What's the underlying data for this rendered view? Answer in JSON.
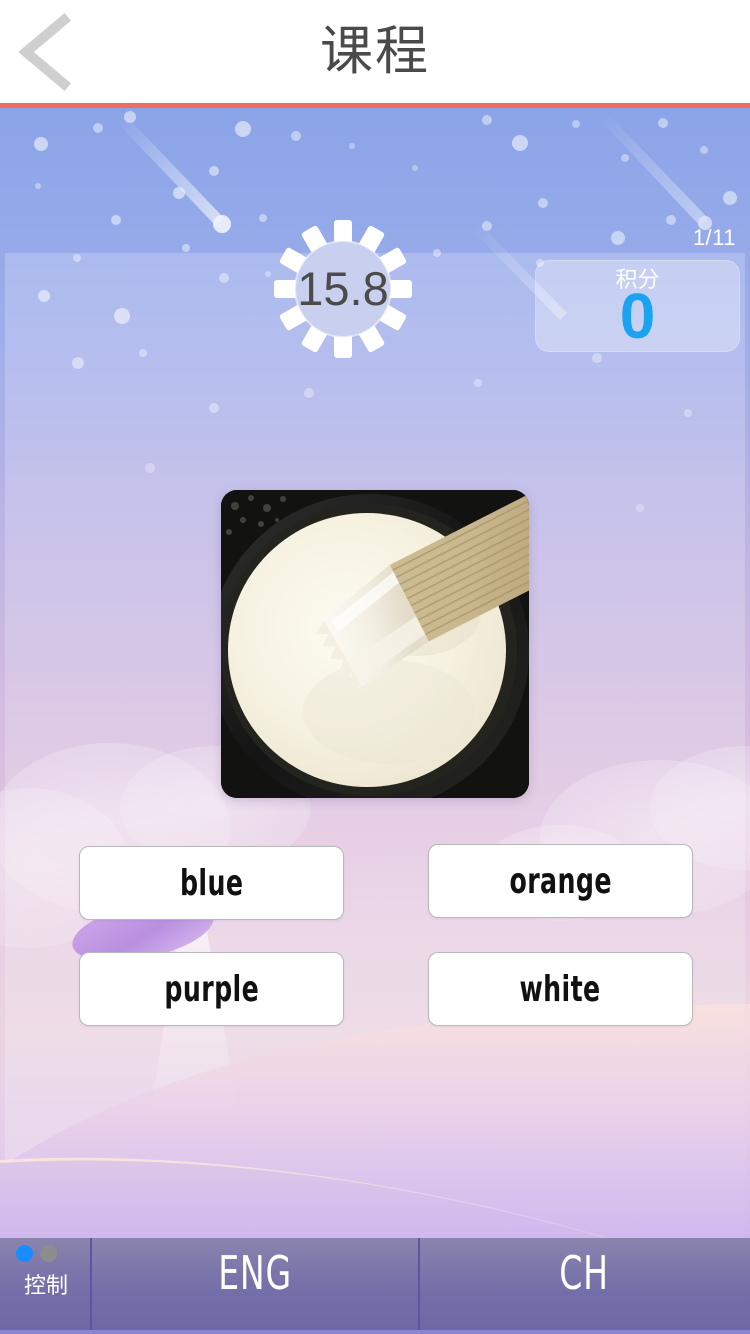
{
  "header": {
    "title": "课程",
    "back_icon": "chevron-left-icon"
  },
  "hud": {
    "timer_value": "15.8",
    "page_counter": "1/11",
    "score_label": "积分",
    "score_value": "0",
    "score_color": "#1aa3f0",
    "timer_segments": 12
  },
  "question": {
    "image_alt": "paint-can-with-white-paint-and-brush",
    "answers": [
      {
        "label": "blue"
      },
      {
        "label": "orange"
      },
      {
        "label": "purple"
      },
      {
        "label": "white"
      }
    ]
  },
  "bottom_bar": {
    "control_label": "控制",
    "dots": [
      {
        "state": "on",
        "color": "#1a8cff"
      },
      {
        "state": "off",
        "color": "#8d8d8d"
      }
    ],
    "eng_label": "ENG",
    "ch_label": "CH"
  },
  "theme": {
    "header_rule": "#ed6d62",
    "sky_top": "#8ba4e8",
    "ground_bottom": "#ddc7ef",
    "bottom_bar": "#736fa8",
    "answer_bg": "#ffffff",
    "answer_border": "#b9b9b9"
  }
}
